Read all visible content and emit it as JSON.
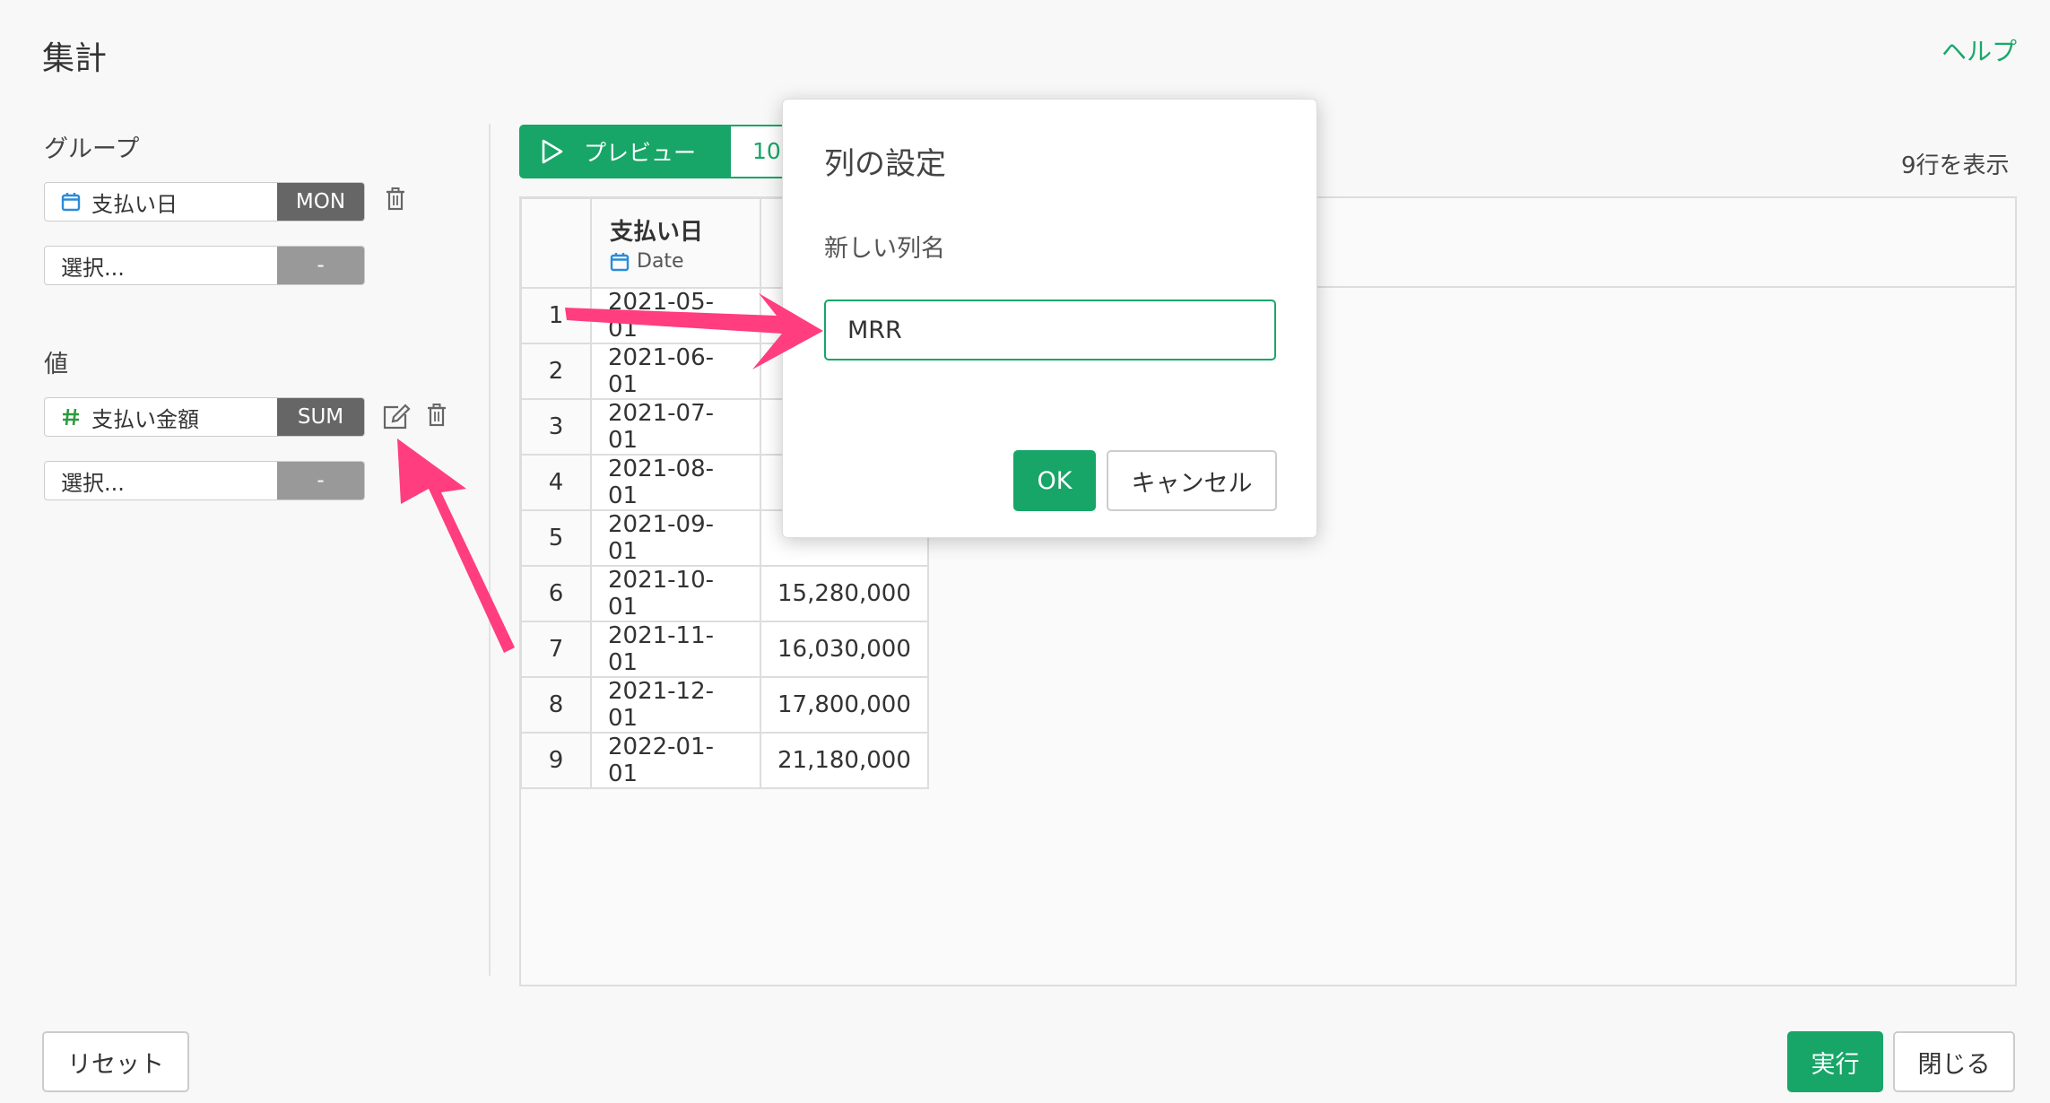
{
  "header": {
    "title": "集計",
    "help_link": "ヘルプ"
  },
  "group": {
    "label": "グループ",
    "items": [
      {
        "column": "支払い日",
        "type_icon": "calendar-icon",
        "agg": "MON"
      }
    ],
    "placeholder": {
      "text": "選択...",
      "agg": "-"
    }
  },
  "values": {
    "label": "値",
    "items": [
      {
        "column": "支払い金額",
        "type_icon": "hash-icon",
        "agg": "SUM"
      }
    ],
    "placeholder": {
      "text": "選択...",
      "agg": "-"
    }
  },
  "preview": {
    "button_label": "プレビュー",
    "row_limit": "10",
    "rows_info": "9行を表示"
  },
  "table": {
    "columns": [
      {
        "name": "支払い日",
        "type": "Date"
      },
      {
        "name": ""
      }
    ],
    "rows": [
      {
        "idx": "1",
        "date": "2021-05-01",
        "amount": ""
      },
      {
        "idx": "2",
        "date": "2021-06-01",
        "amount": ""
      },
      {
        "idx": "3",
        "date": "2021-07-01",
        "amount": ""
      },
      {
        "idx": "4",
        "date": "2021-08-01",
        "amount": ""
      },
      {
        "idx": "5",
        "date": "2021-09-01",
        "amount": ""
      },
      {
        "idx": "6",
        "date": "2021-10-01",
        "amount": "15,280,000"
      },
      {
        "idx": "7",
        "date": "2021-11-01",
        "amount": "16,030,000"
      },
      {
        "idx": "8",
        "date": "2021-12-01",
        "amount": "17,800,000"
      },
      {
        "idx": "9",
        "date": "2022-01-01",
        "amount": "21,180,000"
      }
    ]
  },
  "modal": {
    "title": "列の設定",
    "field_label": "新しい列名",
    "field_value": "MRR",
    "ok_label": "OK",
    "cancel_label": "キャンセル"
  },
  "footer": {
    "reset_label": "リセット",
    "run_label": "実行",
    "close_label": "閉じる"
  },
  "colors": {
    "accent": "#17a668",
    "arrow": "#ff3d7f",
    "agg_badge": "#666666"
  }
}
